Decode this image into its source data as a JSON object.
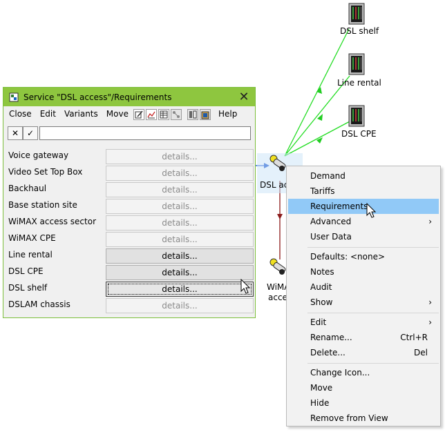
{
  "diagram": {
    "nodes": [
      {
        "id": "dsl-shelf",
        "label": "DSL shelf"
      },
      {
        "id": "line-rental",
        "label": "Line rental"
      },
      {
        "id": "dsl-cpe",
        "label": "DSL CPE"
      },
      {
        "id": "dsl-access",
        "label": "DSL acc"
      },
      {
        "id": "wimax-access",
        "label_line1": "WiMA",
        "label_line2": "acces"
      }
    ],
    "edge_colors": {
      "green": "#22dd22",
      "dark_red": "#8b1a1a",
      "blue": "#0044cc"
    }
  },
  "dialog": {
    "title": "Service \"DSL access\"/Requirements",
    "close_symbol": "✕",
    "titlebar_color": "#8ec63f",
    "menu": {
      "close": "Close",
      "edit": "Edit",
      "variants": "Variants",
      "move": "Move",
      "help": "Help"
    },
    "toolbar_icons": [
      "edit-form-icon",
      "chart-icon",
      "table-icon",
      "network-icon",
      "columns-icon",
      "clipboard-icon"
    ],
    "edit": {
      "cancel_symbol": "✕",
      "ok_symbol": "✓",
      "value": ""
    },
    "rows": [
      {
        "label": "Voice gateway",
        "button": "details...",
        "enabled": false
      },
      {
        "label": "Video Set Top Box",
        "button": "details...",
        "enabled": false
      },
      {
        "label": "Backhaul",
        "button": "details...",
        "enabled": false
      },
      {
        "label": "Base station site",
        "button": "details...",
        "enabled": false
      },
      {
        "label": "WiMAX access sector",
        "button": "details...",
        "enabled": false
      },
      {
        "label": "WiMAX CPE",
        "button": "details...",
        "enabled": false
      },
      {
        "label": "Line rental",
        "button": "details...",
        "enabled": true
      },
      {
        "label": "DSL CPE",
        "button": "details...",
        "enabled": true
      },
      {
        "label": "DSL shelf",
        "button": "details...",
        "enabled": true,
        "focused": true
      },
      {
        "label": "DSLAM chassis",
        "button": "details...",
        "enabled": false
      }
    ]
  },
  "context_menu": {
    "highlight_color": "#91c9f7",
    "items": [
      {
        "label": "Demand"
      },
      {
        "label": "Tariffs"
      },
      {
        "label": "Requirements",
        "highlighted": true
      },
      {
        "label": "Advanced",
        "submenu": true
      },
      {
        "label": "User Data"
      },
      {
        "label": "Defaults: <none>"
      },
      {
        "label": "Notes"
      },
      {
        "label": "Audit"
      },
      {
        "label": "Show",
        "submenu": true
      },
      {
        "label": "Edit",
        "submenu": true
      },
      {
        "label": "Rename...",
        "shortcut": "Ctrl+R"
      },
      {
        "label": "Delete...",
        "shortcut": "Del"
      },
      {
        "label": "Change Icon..."
      },
      {
        "label": "Move"
      },
      {
        "label": "Hide"
      },
      {
        "label": "Remove from View"
      }
    ],
    "submenu_arrow": "›"
  }
}
